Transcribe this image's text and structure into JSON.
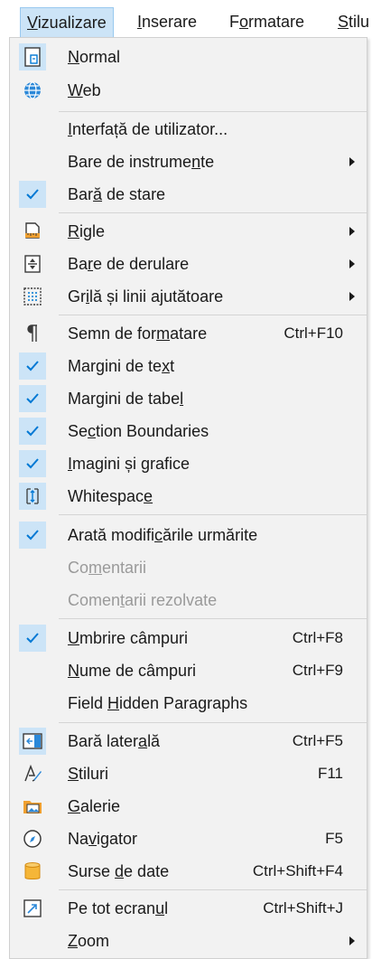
{
  "menubar": {
    "items": [
      {
        "pre": "",
        "u": "V",
        "post": "izualizare"
      },
      {
        "pre": "",
        "u": "I",
        "post": "nserare"
      },
      {
        "pre": "F",
        "u": "o",
        "post": "rmatare"
      },
      {
        "pre": "",
        "u": "S",
        "post": "tilu"
      }
    ]
  },
  "menu": {
    "items": [
      {
        "pre": "",
        "u": "N",
        "post": "ormal",
        "icon": "normal-view-icon",
        "checked": true
      },
      {
        "pre": "",
        "u": "W",
        "post": "eb",
        "icon": "globe-icon"
      },
      {
        "pre": "",
        "u": "I",
        "post": "nterfață de utilizator...",
        "icon": ""
      },
      {
        "pre": "Bare de instrume",
        "u": "n",
        "post": "te",
        "icon": "",
        "submenu": true
      },
      {
        "pre": "Bar",
        "u": "ă",
        "post": " de stare",
        "icon": "check-icon",
        "checked": true
      },
      {
        "pre": "",
        "u": "R",
        "post": "igle",
        "icon": "ruler-icon",
        "submenu": true
      },
      {
        "pre": "Ba",
        "u": "r",
        "post": "e de derulare",
        "icon": "scrollbar-icon",
        "submenu": true
      },
      {
        "pre": "Gr",
        "u": "i",
        "post": "lă și linii ajutătoare",
        "icon": "grid-icon",
        "submenu": true
      },
      {
        "pre": "Semn de for",
        "u": "m",
        "post": "atare",
        "icon": "pilcrow-icon",
        "shortcut": "Ctrl+F10"
      },
      {
        "pre": "Margini de te",
        "u": "x",
        "post": "t",
        "icon": "check-icon",
        "checked": true
      },
      {
        "pre": "Margini de tabe",
        "u": "l",
        "post": "",
        "icon": "check-icon",
        "checked": true
      },
      {
        "pre": "Se",
        "u": "c",
        "post": "tion Boundaries",
        "icon": "check-icon",
        "checked": true
      },
      {
        "pre": "",
        "u": "I",
        "post": "magini și grafice",
        "icon": "check-icon",
        "checked": true
      },
      {
        "pre": "Whitespac",
        "u": "e",
        "post": "",
        "icon": "whitespace-icon",
        "checked": true
      },
      {
        "pre": "Arată modifi",
        "u": "c",
        "post": "ările urmărite",
        "icon": "check-icon",
        "checked": true
      },
      {
        "pre": "Co",
        "u": "m",
        "post": "entarii",
        "icon": "",
        "disabled": true
      },
      {
        "pre": "Comen",
        "u": "t",
        "post": "arii rezolvate",
        "icon": "",
        "disabled": true
      },
      {
        "pre": "",
        "u": "U",
        "post": "mbrire câmpuri",
        "icon": "check-icon",
        "checked": true,
        "shortcut": "Ctrl+F8"
      },
      {
        "pre": "",
        "u": "N",
        "post": "ume de câmpuri",
        "icon": "",
        "shortcut": "Ctrl+F9"
      },
      {
        "pre": "Field ",
        "u": "H",
        "post": "idden Paragraphs",
        "icon": ""
      },
      {
        "pre": "Bară later",
        "u": "a",
        "post": "lă",
        "icon": "sidebar-icon",
        "checked": true,
        "shortcut": "Ctrl+F5"
      },
      {
        "pre": "",
        "u": "S",
        "post": "tiluri",
        "icon": "styles-icon",
        "shortcut": "F11"
      },
      {
        "pre": "",
        "u": "G",
        "post": "alerie",
        "icon": "gallery-icon"
      },
      {
        "pre": "Na",
        "u": "v",
        "post": "igator",
        "icon": "navigator-icon",
        "shortcut": "F5"
      },
      {
        "pre": "Surse ",
        "u": "d",
        "post": "e date",
        "icon": "database-icon",
        "shortcut": "Ctrl+Shift+F4"
      },
      {
        "pre": "Pe tot ecran",
        "u": "u",
        "post": "l",
        "icon": "fullscreen-icon",
        "shortcut": "Ctrl+Shift+J"
      },
      {
        "pre": "",
        "u": "Z",
        "post": "oom",
        "icon": "",
        "submenu": true
      }
    ]
  },
  "colors": {
    "highlight": "#cce4f7",
    "check": "#0078d4",
    "disabled_text": "#9a9a9a",
    "menu_bg": "#f2f2f2"
  }
}
